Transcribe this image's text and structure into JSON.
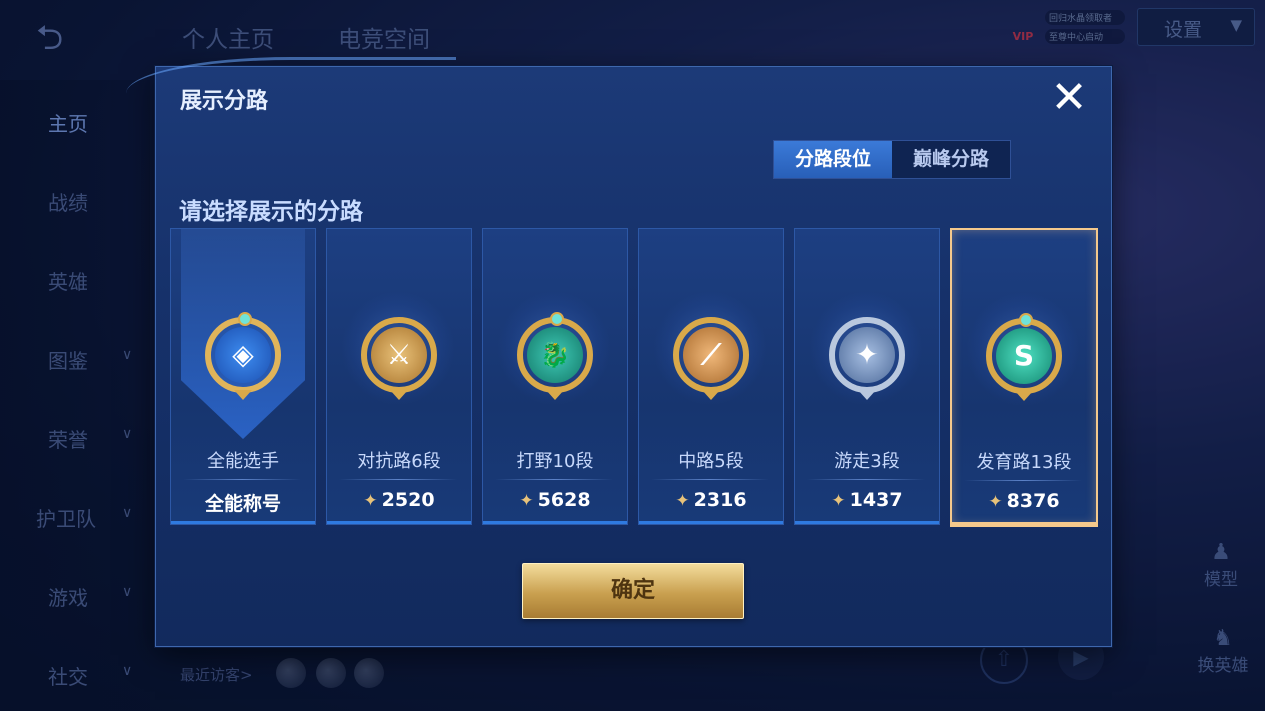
{
  "topbar": {
    "tabs": [
      "个人主页",
      "电竞空间"
    ],
    "vip_label": "VIP",
    "vip_lines": [
      "回归水晶领取者",
      "至尊中心启动"
    ],
    "settings_label": "设置"
  },
  "sidebar": {
    "items": [
      {
        "label": "主页"
      },
      {
        "label": "战绩"
      },
      {
        "label": "英雄"
      },
      {
        "label": "图鉴"
      },
      {
        "label": "荣誉"
      },
      {
        "label": "护卫队"
      },
      {
        "label": "游戏"
      },
      {
        "label": "社交"
      }
    ]
  },
  "bottom": {
    "recent_visitors": "最近访客>",
    "model_label": "模型",
    "change_hero_label": "换英雄"
  },
  "modal": {
    "title": "展示分路",
    "close_glyph": "✕",
    "segments": [
      "分路段位",
      "巅峰分路"
    ],
    "active_segment": "分路段位",
    "prompt": "请选择展示的分路",
    "cards": [
      {
        "role": "全能选手",
        "score": "全能称号",
        "icon": "all-round-badge-icon",
        "glyph": "◈",
        "color": "#2a6fd6",
        "selected": false
      },
      {
        "role": "对抗路6段",
        "score": "2520",
        "icon": "clash-lane-badge-icon",
        "glyph": "⚔",
        "color": "#c9913a",
        "selected": false
      },
      {
        "role": "打野10段",
        "score": "5628",
        "icon": "jungle-badge-icon",
        "glyph": "🐉",
        "color": "#1f9a8e",
        "selected": false
      },
      {
        "role": "中路5段",
        "score": "2316",
        "icon": "mid-lane-badge-icon",
        "glyph": "⟋",
        "color": "#c98a3a",
        "selected": false
      },
      {
        "role": "游走3段",
        "score": "1437",
        "icon": "roam-badge-icon",
        "glyph": "✦",
        "color": "#7e97bf",
        "selected": false
      },
      {
        "role": "发育路13段",
        "score": "8376",
        "icon": "farm-lane-badge-icon",
        "glyph": "S",
        "color": "#25b59b",
        "selected": true
      }
    ],
    "confirm_label": "确定"
  }
}
